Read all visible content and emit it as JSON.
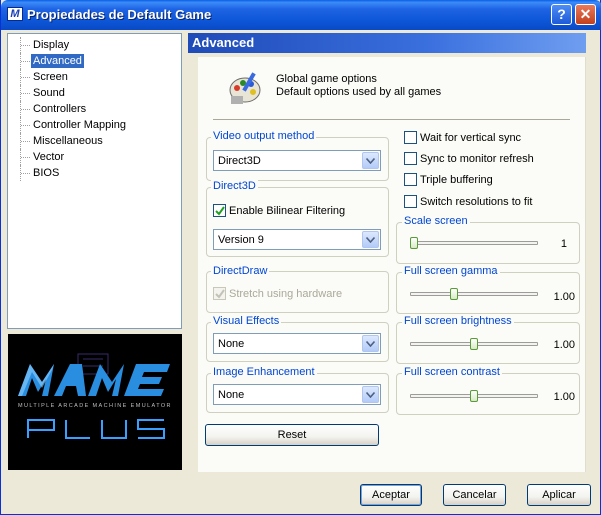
{
  "window": {
    "title": "Propiedades de Default Game",
    "help_label": "?",
    "close_label": "✕",
    "icon_letter": "M"
  },
  "tree": {
    "items": [
      {
        "label": "Display"
      },
      {
        "label": "Advanced"
      },
      {
        "label": "Screen"
      },
      {
        "label": "Sound"
      },
      {
        "label": "Controllers"
      },
      {
        "label": "Controller Mapping"
      },
      {
        "label": "Miscellaneous"
      },
      {
        "label": "Vector"
      },
      {
        "label": "BIOS"
      }
    ],
    "selected": "Advanced"
  },
  "logo": {
    "text": "MAME PLUS",
    "subtitle": "MULTIPLE ARCADE MACHINE EMULATOR"
  },
  "header": {
    "title": "Advanced"
  },
  "intro": {
    "line1": "Global game options",
    "line2": "Default options used by all games"
  },
  "video_output": {
    "label": "Video output method",
    "value": "Direct3D"
  },
  "direct3d": {
    "label": "Direct3D",
    "bilinear_label": "Enable Bilinear Filtering",
    "bilinear_checked": true,
    "version_value": "Version 9"
  },
  "directdraw": {
    "label": "DirectDraw",
    "stretch_label": "Stretch using hardware",
    "stretch_checked": true,
    "stretch_disabled": true
  },
  "visual_effects": {
    "label": "Visual Effects",
    "value": "None"
  },
  "image_enhancement": {
    "label": "Image Enhancement",
    "value": "None"
  },
  "options": {
    "vsync_label": "Wait for vertical sync",
    "sync_refresh_label": "Sync to monitor refresh",
    "triple_buffer_label": "Triple buffering",
    "switch_res_label": "Switch resolutions to fit"
  },
  "sliders": {
    "scale": {
      "label": "Scale screen",
      "value": "1",
      "level": 0.0
    },
    "gamma": {
      "label": "Full screen gamma",
      "value": "1.00",
      "level": 0.33
    },
    "brightness": {
      "label": "Full screen brightness",
      "value": "1.00",
      "level": 0.5
    },
    "contrast": {
      "label": "Full screen contrast",
      "value": "1.00",
      "level": 0.5
    }
  },
  "buttons": {
    "reset": "Reset",
    "accept": "Aceptar",
    "cancel": "Cancelar",
    "apply": "Aplicar"
  },
  "colors": {
    "accent": "#0046d5",
    "selection": "#316ac5",
    "titlebar": "#0a5ee6"
  }
}
